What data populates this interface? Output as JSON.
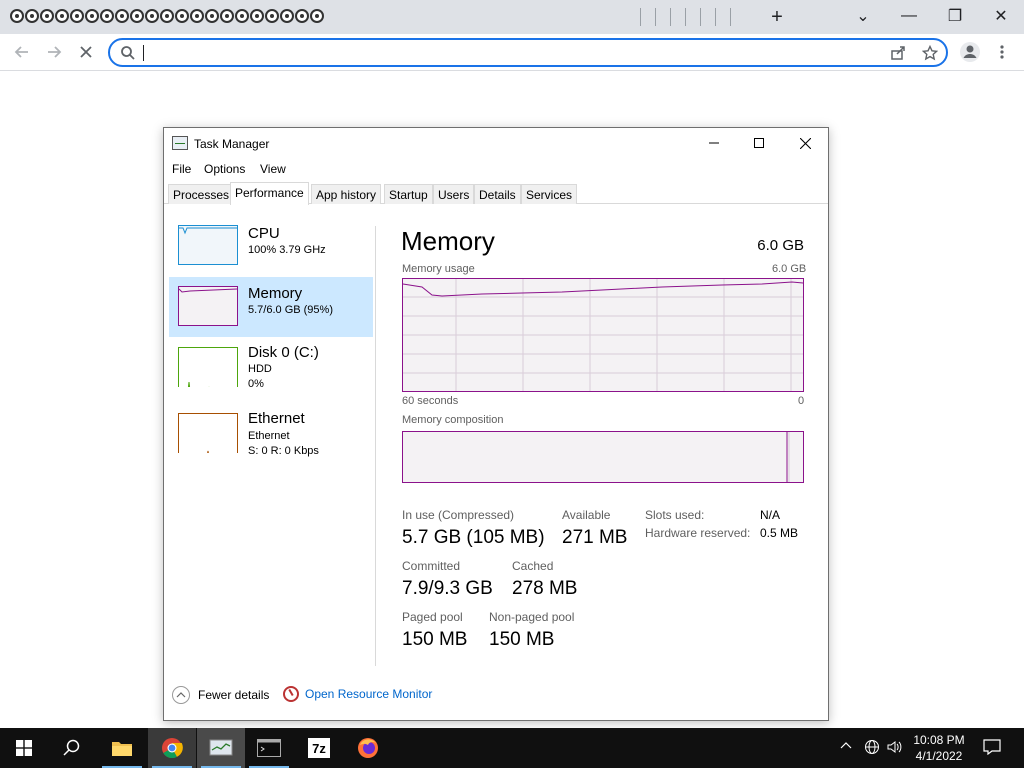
{
  "browser": {
    "window_controls": {
      "tab_search": "⌄",
      "minimize": "—",
      "restore": "❐",
      "close": "✕"
    },
    "new_tab_label": "+",
    "address_bar": {
      "value": "",
      "placeholder": ""
    }
  },
  "task_manager": {
    "title": "Task Manager",
    "menu": [
      "File",
      "Options",
      "View"
    ],
    "tabs": [
      "Processes",
      "Performance",
      "App history",
      "Startup",
      "Users",
      "Details",
      "Services"
    ],
    "active_tab": "Performance",
    "sidebar": [
      {
        "name": "CPU",
        "sub1": "100%  3.79 GHz",
        "sub2": "",
        "color": "#1b8fd2"
      },
      {
        "name": "Memory",
        "sub1": "5.7/6.0 GB (95%)",
        "sub2": "",
        "color": "#8b128b"
      },
      {
        "name": "Disk 0 (C:)",
        "sub1": "HDD",
        "sub2": "0%",
        "color": "#4da60c"
      },
      {
        "name": "Ethernet",
        "sub1": "Ethernet",
        "sub2": "S: 0  R: 0 Kbps",
        "color": "#a74f01"
      }
    ],
    "main": {
      "title": "Memory",
      "total": "6.0 GB",
      "usage_label": "Memory usage",
      "usage_max": "6.0 GB",
      "time_left": "60 seconds",
      "time_right": "0",
      "composition_label": "Memory composition",
      "stats": {
        "in_use_label": "In use (Compressed)",
        "in_use_value": "5.7 GB (105 MB)",
        "available_label": "Available",
        "available_value": "271 MB",
        "committed_label": "Committed",
        "committed_value": "7.9/9.3 GB",
        "cached_label": "Cached",
        "cached_value": "278 MB",
        "paged_label": "Paged pool",
        "paged_value": "150 MB",
        "nonpaged_label": "Non-paged pool",
        "nonpaged_value": "150 MB",
        "slots_label": "Slots used:",
        "slots_value": "N/A",
        "hw_label": "Hardware reserved:",
        "hw_value": "0.5 MB"
      }
    },
    "footer": {
      "fewer_details": "Fewer details",
      "resource_monitor": "Open Resource Monitor"
    }
  },
  "taskbar": {
    "time": "10:08 PM",
    "date": "4/1/2022",
    "apps": [
      "start-icon",
      "search-icon",
      "file-explorer-icon",
      "chrome-icon",
      "task-manager-icon",
      "terminal-icon",
      "7zip-icon",
      "firefox-icon"
    ],
    "sevenzip_label": "7z"
  }
}
